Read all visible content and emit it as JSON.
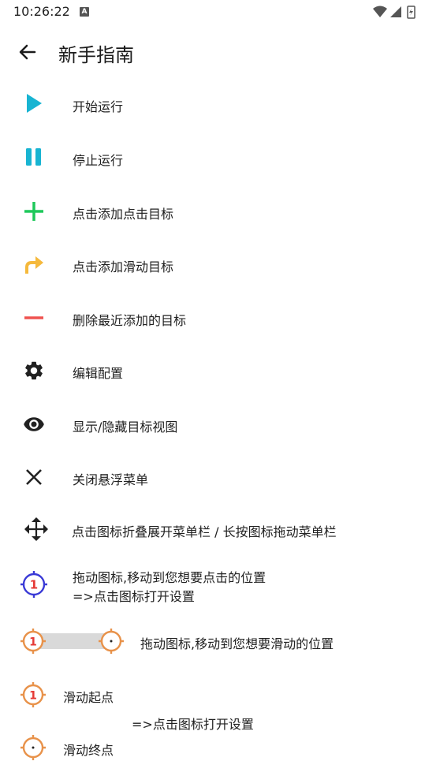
{
  "status": {
    "time": "10:26:22",
    "notification_badge": "A"
  },
  "toolbar": {
    "title": "新手指南",
    "back_icon": "arrow-left-icon"
  },
  "guide": {
    "start": "开始运行",
    "stop": "停止运行",
    "add_click": "点击添加点击目标",
    "add_swipe": "点击添加滑动目标",
    "remove_last": "删除最近添加的目标",
    "edit_config": "编辑配置",
    "toggle_view": "显示/隐藏目标视图",
    "close_menu": "关闭悬浮菜单",
    "move_menu": "点击图标折叠展开菜单栏 / 长按图标拖动菜单栏",
    "click_target_line1": "拖动图标,移动到您想要点击的位置",
    "click_target_line2": "=>点击图标打开设置",
    "swipe_target": "拖动图标,移动到您想要滑动的位置",
    "swipe_start": "滑动起点",
    "swipe_settings": "=>点击图标打开设置",
    "swipe_end": "滑动终点",
    "target_number": "1"
  },
  "colors": {
    "play": "#18b4d2",
    "pause": "#18b4d2",
    "plus": "#1ec85a",
    "swipe_arrow": "#f5b93c",
    "minus": "#ef5350",
    "dark": "#212121",
    "click_target": "#3a3ad6",
    "swipe_target": "#e8924a"
  }
}
